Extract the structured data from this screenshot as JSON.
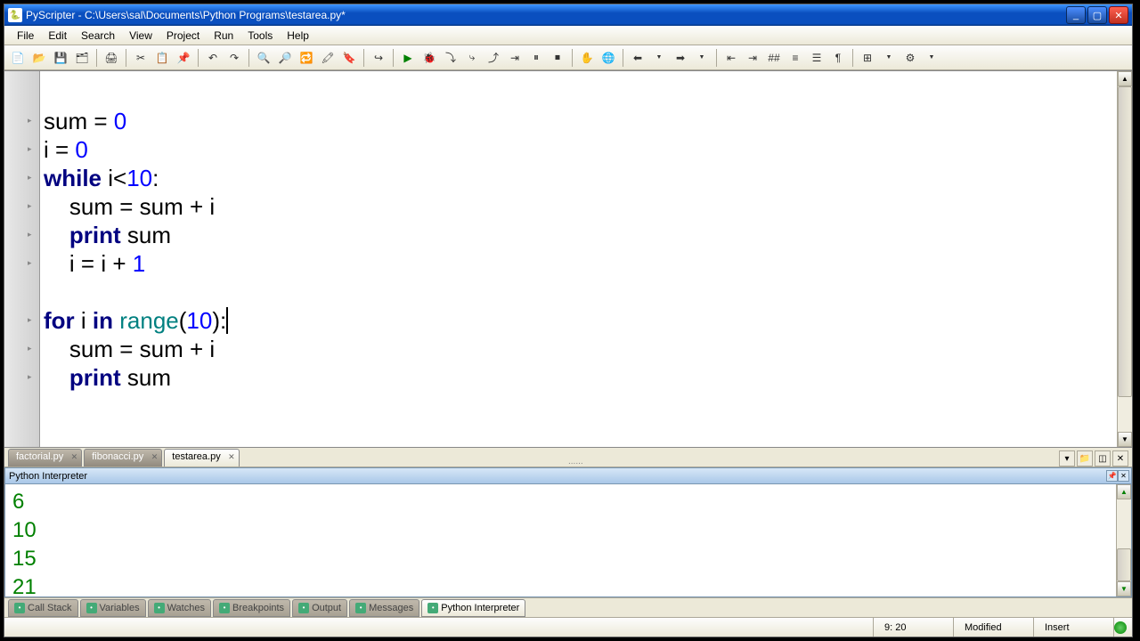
{
  "window": {
    "title": "PyScripter - C:\\Users\\sal\\Documents\\Python Programs\\testarea.py*"
  },
  "menu": {
    "file": "File",
    "edit": "Edit",
    "search": "Search",
    "view": "View",
    "project": "Project",
    "run": "Run",
    "tools": "Tools",
    "help": "Help"
  },
  "code": {
    "lines": [
      {
        "indent": "",
        "tokens": []
      },
      {
        "indent": "",
        "tokens": [
          {
            "t": "",
            "c": "sum = "
          },
          {
            "t": "num",
            "c": "0"
          }
        ]
      },
      {
        "indent": "",
        "tokens": [
          {
            "t": "",
            "c": "i = "
          },
          {
            "t": "num",
            "c": "0"
          }
        ]
      },
      {
        "indent": "",
        "tokens": [
          {
            "t": "kw",
            "c": "while"
          },
          {
            "t": "",
            "c": " i<"
          },
          {
            "t": "num",
            "c": "10"
          },
          {
            "t": "",
            "c": ":"
          }
        ]
      },
      {
        "indent": "    ",
        "tokens": [
          {
            "t": "",
            "c": "sum = sum + i"
          }
        ]
      },
      {
        "indent": "    ",
        "tokens": [
          {
            "t": "kw",
            "c": "print"
          },
          {
            "t": "",
            "c": " sum"
          }
        ]
      },
      {
        "indent": "    ",
        "tokens": [
          {
            "t": "",
            "c": "i = i + "
          },
          {
            "t": "num",
            "c": "1"
          }
        ]
      },
      {
        "indent": "",
        "tokens": []
      },
      {
        "indent": "",
        "tokens": [
          {
            "t": "kw",
            "c": "for"
          },
          {
            "t": "",
            "c": " i "
          },
          {
            "t": "kw",
            "c": "in"
          },
          {
            "t": "",
            "c": " "
          },
          {
            "t": "fn",
            "c": "range"
          },
          {
            "t": "",
            "c": "("
          },
          {
            "t": "num",
            "c": "10"
          },
          {
            "t": "",
            "c": "):"
          }
        ],
        "cursor": true
      },
      {
        "indent": "    ",
        "tokens": [
          {
            "t": "",
            "c": "sum = sum + i"
          }
        ]
      },
      {
        "indent": "    ",
        "tokens": [
          {
            "t": "kw",
            "c": "print"
          },
          {
            "t": "",
            "c": " sum"
          }
        ]
      }
    ]
  },
  "file_tabs": [
    {
      "label": "factorial.py",
      "active": false
    },
    {
      "label": "fibonacci.py",
      "active": false
    },
    {
      "label": "testarea.py",
      "active": true
    }
  ],
  "interpreter": {
    "title": "Python Interpreter",
    "output": [
      "6",
      "10",
      "15",
      "21"
    ]
  },
  "bottom_tabs": [
    {
      "label": "Call Stack",
      "active": false
    },
    {
      "label": "Variables",
      "active": false
    },
    {
      "label": "Watches",
      "active": false
    },
    {
      "label": "Breakpoints",
      "active": false
    },
    {
      "label": "Output",
      "active": false
    },
    {
      "label": "Messages",
      "active": false
    },
    {
      "label": "Python Interpreter",
      "active": true
    }
  ],
  "status": {
    "position": "9: 20",
    "modified": "Modified",
    "mode": "Insert"
  },
  "tabbar_dots": "......"
}
